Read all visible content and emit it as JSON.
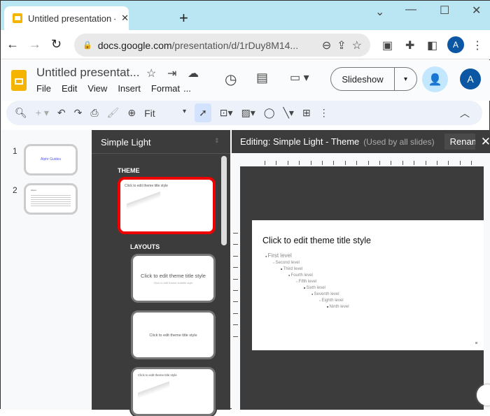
{
  "browser": {
    "tab_title": "Untitled presentation - Google Slides",
    "url_host": "docs.google.com",
    "url_path": "/presentation/d/1rDuy8M14...",
    "avatar": "A"
  },
  "app": {
    "doc_title": "Untitled presentat...",
    "menu": [
      "File",
      "Edit",
      "View",
      "Insert",
      "Format",
      "..."
    ],
    "slideshow_label": "Slideshow",
    "avatar": "A"
  },
  "toolbar": {
    "zoom": "Fit"
  },
  "filmstrip": {
    "slides": [
      {
        "number": "1",
        "text": "Alphr Guides"
      },
      {
        "number": "2",
        "text": "About"
      }
    ]
  },
  "theme_panel": {
    "title": "Simple Light",
    "theme_label": "THEME",
    "layouts_label": "LAYOUTS",
    "thumb_title": "Click to edit theme title style",
    "thumb_subtitle": "Click to edit theme subtitle style"
  },
  "editor": {
    "heading": "Editing: Simple Light - Theme",
    "subheading": "(Used by all slides)",
    "rename_label": "Rename",
    "slide_title": "Click to edit theme title style",
    "levels": [
      "First level",
      "Second level",
      "Third level",
      "Fourth level",
      "Fifth level",
      "Sixth level",
      "Seventh level",
      "Eighth level",
      "Ninth level"
    ]
  }
}
